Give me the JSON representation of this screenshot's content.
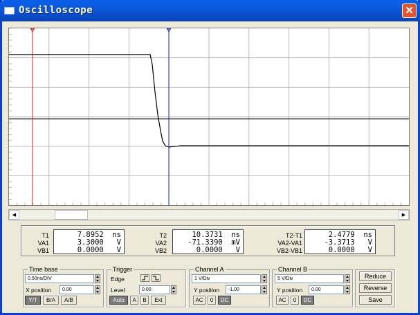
{
  "window": {
    "title": "Oscilloscope",
    "close_label": "✕"
  },
  "colors": {
    "cursor1": "#e02020",
    "cursor2": "#1a2ecc",
    "grid": "#b8b8b8",
    "trace": "#000000"
  },
  "cursors": {
    "c1_label": "1",
    "c2_label": "2"
  },
  "readout": {
    "col1": {
      "labels": [
        "T1",
        "VA1",
        "VB1"
      ],
      "values": [
        "7.8952  ns",
        "3.3000   V",
        "0.0000   V"
      ]
    },
    "col2": {
      "labels": [
        "T2",
        "VA2",
        "VB2"
      ],
      "values": [
        "10.3731  ns",
        "-71.3390  mV",
        "0.0000   V"
      ]
    },
    "col3": {
      "labels": [
        "T2-T1",
        "VA2-VA1",
        "VB2-VB1"
      ],
      "values": [
        "2.4779  ns",
        "-3.3713   V",
        "0.0000   V"
      ]
    }
  },
  "timebase": {
    "title": "Time base",
    "scale": "0.50ns/DIV",
    "xpos_label": "X position",
    "xpos_value": "0.00",
    "buttons": [
      "Y/T",
      "B/A",
      "A/B"
    ]
  },
  "trigger": {
    "title": "Trigger",
    "edge_label": "Edge",
    "level_label": "Level",
    "level_value": "0.00",
    "buttons": [
      "Auto",
      "A",
      "B",
      "Ext"
    ]
  },
  "channel_a": {
    "title": "Channel A",
    "scale": "1 V/Div",
    "ypos_label": "Y position",
    "ypos_value": "-1.00",
    "coupling": [
      "AC",
      "0",
      "DC"
    ]
  },
  "channel_b": {
    "title": "Channel B",
    "scale": "5 V/Div",
    "ypos_label": "Y position",
    "ypos_value": "0.00",
    "coupling": [
      "AC",
      "0",
      "DC"
    ]
  },
  "actions": {
    "reduce": "Reduce",
    "reverse": "Reverse",
    "save": "Save"
  }
}
